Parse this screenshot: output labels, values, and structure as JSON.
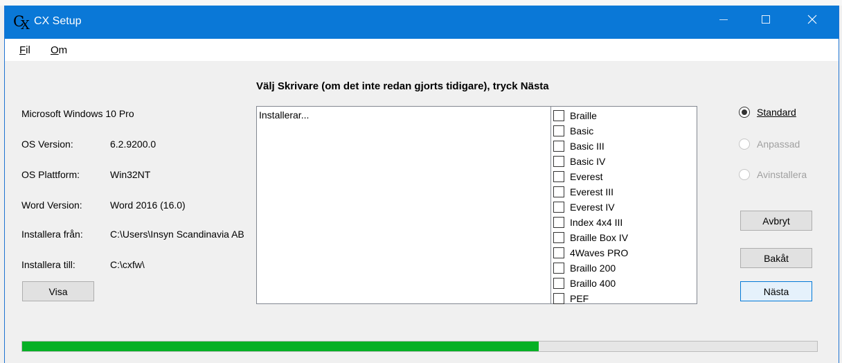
{
  "window": {
    "title": "CX Setup",
    "icon_letter": "C",
    "icon_sub": "X"
  },
  "menu": {
    "file": "Fil",
    "about": "Om"
  },
  "heading": "Välj Skrivare (om det inte redan gjorts tidigare), tryck Nästa",
  "info": {
    "os_name": "Microsoft Windows 10 Pro",
    "rows": [
      {
        "label": "OS Version:",
        "value": "6.2.9200.0"
      },
      {
        "label": "OS Plattform:",
        "value": "Win32NT"
      },
      {
        "label": "Word Version:",
        "value": "Word 2016 (16.0)"
      },
      {
        "label": "Installera från:",
        "value": "C:\\Users\\Insyn Scandinavia AB"
      },
      {
        "label": "Installera till:",
        "value": "C:\\cxfw\\"
      }
    ]
  },
  "buttons": {
    "visa": "Visa",
    "avbryt": "Avbryt",
    "bakat": "Bakåt",
    "nasta": "Nästa"
  },
  "log": {
    "text": "Installerar..."
  },
  "printers": [
    "Braille",
    "Basic",
    "Basic III",
    "Basic IV",
    "Everest",
    "Everest III",
    "Everest IV",
    "Index 4x4 III",
    "Braille Box IV",
    "4Waves PRO",
    "Braillo 200",
    "Braillo 400",
    "PEF"
  ],
  "options": [
    {
      "label": "Standard",
      "checked": true,
      "enabled": true
    },
    {
      "label": "Anpassad",
      "checked": false,
      "enabled": false
    },
    {
      "label": "Avinstallera",
      "checked": false,
      "enabled": false
    }
  ],
  "progress": {
    "percent": 65,
    "color": "#06b025"
  },
  "colors": {
    "titlebar": "#0a78d7"
  }
}
